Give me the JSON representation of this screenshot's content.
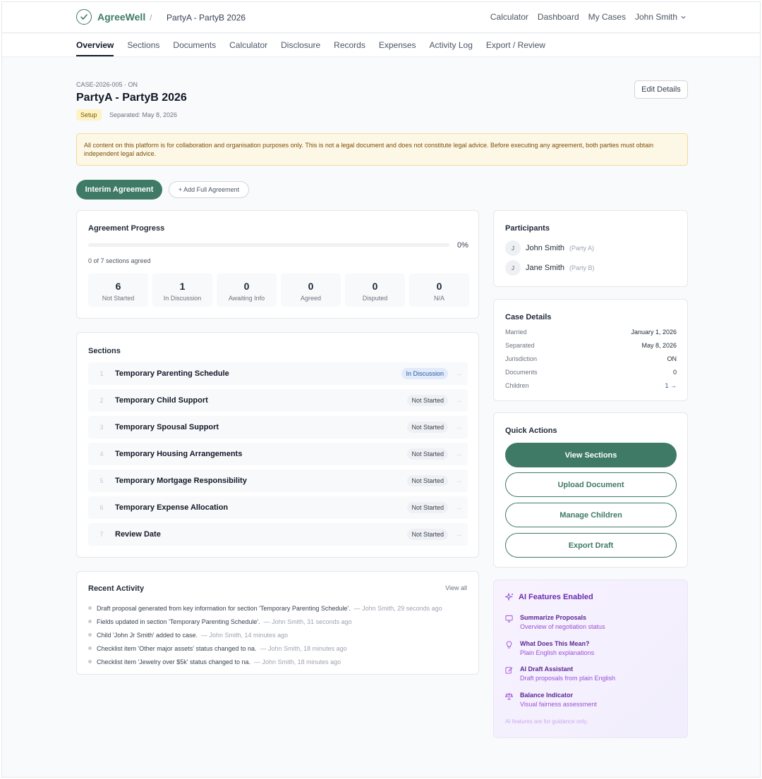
{
  "header": {
    "brand": "AgreeWell",
    "breadcrumb_sep": "/",
    "breadcrumb_case": "PartyA - PartyB 2026",
    "nav": [
      "Calculator",
      "Dashboard",
      "My Cases"
    ],
    "user": "John Smith"
  },
  "tabs": [
    "Overview",
    "Sections",
    "Documents",
    "Calculator",
    "Disclosure",
    "Records",
    "Expenses",
    "Activity Log",
    "Export / Review"
  ],
  "case": {
    "id_line": "CASE-2026-005 · ON",
    "title": "PartyA - PartyB 2026",
    "status": "Setup",
    "separated_line": "Separated: May 8, 2026",
    "edit_label": "Edit Details"
  },
  "disclaimer": "All content on this platform is for collaboration and organisation purposes only. This is not a legal document and does not constitute legal advice. Before executing any agreement, both parties must obtain independent legal advice.",
  "agreement_buttons": {
    "interim": "Interim Agreement",
    "add_full": "+ Add Full Agreement"
  },
  "progress": {
    "title": "Agreement Progress",
    "percent_label": "0%",
    "percent": 0,
    "summary": "0 of 7 sections agreed",
    "stats": [
      {
        "value": "6",
        "label": "Not Started"
      },
      {
        "value": "1",
        "label": "In Discussion"
      },
      {
        "value": "0",
        "label": "Awaiting Info"
      },
      {
        "value": "0",
        "label": "Agreed"
      },
      {
        "value": "0",
        "label": "Disputed"
      },
      {
        "value": "0",
        "label": "N/A"
      }
    ]
  },
  "sections": {
    "title": "Sections",
    "arrow": "→",
    "items": [
      {
        "num": "1",
        "title": "Temporary Parenting Schedule",
        "status": "In Discussion"
      },
      {
        "num": "2",
        "title": "Temporary Child Support",
        "status": "Not Started"
      },
      {
        "num": "3",
        "title": "Temporary Spousal Support",
        "status": "Not Started"
      },
      {
        "num": "4",
        "title": "Temporary Housing Arrangements",
        "status": "Not Started"
      },
      {
        "num": "5",
        "title": "Temporary Mortgage Responsibility",
        "status": "Not Started"
      },
      {
        "num": "6",
        "title": "Temporary Expense Allocation",
        "status": "Not Started"
      },
      {
        "num": "7",
        "title": "Review Date",
        "status": "Not Started"
      }
    ]
  },
  "activity": {
    "title": "Recent Activity",
    "view_all": "View all",
    "items": [
      {
        "text": "Draft proposal generated from key information for section 'Temporary Parenting Schedule'.",
        "meta": "— John Smith, 29 seconds ago"
      },
      {
        "text": "Fields updated in section 'Temporary Parenting Schedule'.",
        "meta": "— John Smith, 31 seconds ago"
      },
      {
        "text": "Child 'John Jr Smith' added to case.",
        "meta": "— John Smith, 14 minutes ago"
      },
      {
        "text": "Checklist item 'Other major assets' status changed to na.",
        "meta": "— John Smith, 18 minutes ago"
      },
      {
        "text": "Checklist item 'Jewelry over $5k' status changed to na.",
        "meta": "— John Smith, 18 minutes ago"
      }
    ]
  },
  "participants": {
    "title": "Participants",
    "items": [
      {
        "initial": "J",
        "name": "John Smith",
        "role": "(Party A)"
      },
      {
        "initial": "J",
        "name": "Jane Smith",
        "role": "(Party B)"
      }
    ]
  },
  "case_details": {
    "title": "Case Details",
    "rows": [
      {
        "key": "Married",
        "value": "January 1, 2026"
      },
      {
        "key": "Separated",
        "value": "May 8, 2026"
      },
      {
        "key": "Jurisdiction",
        "value": "ON"
      },
      {
        "key": "Documents",
        "value": "0"
      },
      {
        "key": "Children",
        "value": "1 →"
      }
    ]
  },
  "quick_actions": {
    "title": "Quick Actions",
    "buttons": [
      "View Sections",
      "Upload Document",
      "Manage Children",
      "Export Draft"
    ]
  },
  "ai": {
    "title": "AI Features Enabled",
    "features": [
      {
        "icon": "monitor-icon",
        "title": "Summarize Proposals",
        "desc": "Overview of negotiation status"
      },
      {
        "icon": "lightbulb-icon",
        "title": "What Does This Mean?",
        "desc": "Plain English explanations"
      },
      {
        "icon": "pencil-icon",
        "title": "AI Draft Assistant",
        "desc": "Draft proposals from plain English"
      },
      {
        "icon": "scale-icon",
        "title": "Balance Indicator",
        "desc": "Visual fairness assessment"
      }
    ],
    "footer": "AI features are for guidance only."
  },
  "colors": {
    "brand": "#3e7a66",
    "ai_purple": "#6b2bb0",
    "warning_bg": "#fdf8e6",
    "discussion_blue": "#2c5aa0"
  }
}
